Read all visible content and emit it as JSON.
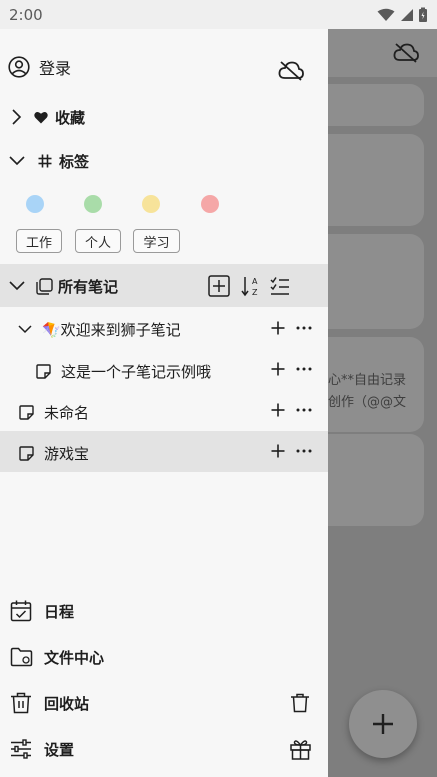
{
  "status": {
    "time": "2:00"
  },
  "drawer": {
    "login_label": "登录",
    "favorites_label": "收藏",
    "tags_label": "标签",
    "tag_colors": [
      "#a9d4f7",
      "#a9dca9",
      "#f7e39a",
      "#f5a7a7"
    ],
    "tags": [
      "工作",
      "个人",
      "学习"
    ],
    "all_notes_label": "所有笔记",
    "notes": [
      {
        "title": "🪁欢迎来到狮子笔记"
      },
      {
        "title": "这是一个子笔记示例哦"
      },
      {
        "title": "未命名"
      },
      {
        "title": "游戏宝"
      }
    ],
    "bottom": {
      "schedule": "日程",
      "files": "文件中心",
      "trash": "回收站",
      "settings": "设置"
    }
  },
  "background": {
    "snippet_1": "心**自由记录",
    "snippet_2": "创作（@@文"
  }
}
